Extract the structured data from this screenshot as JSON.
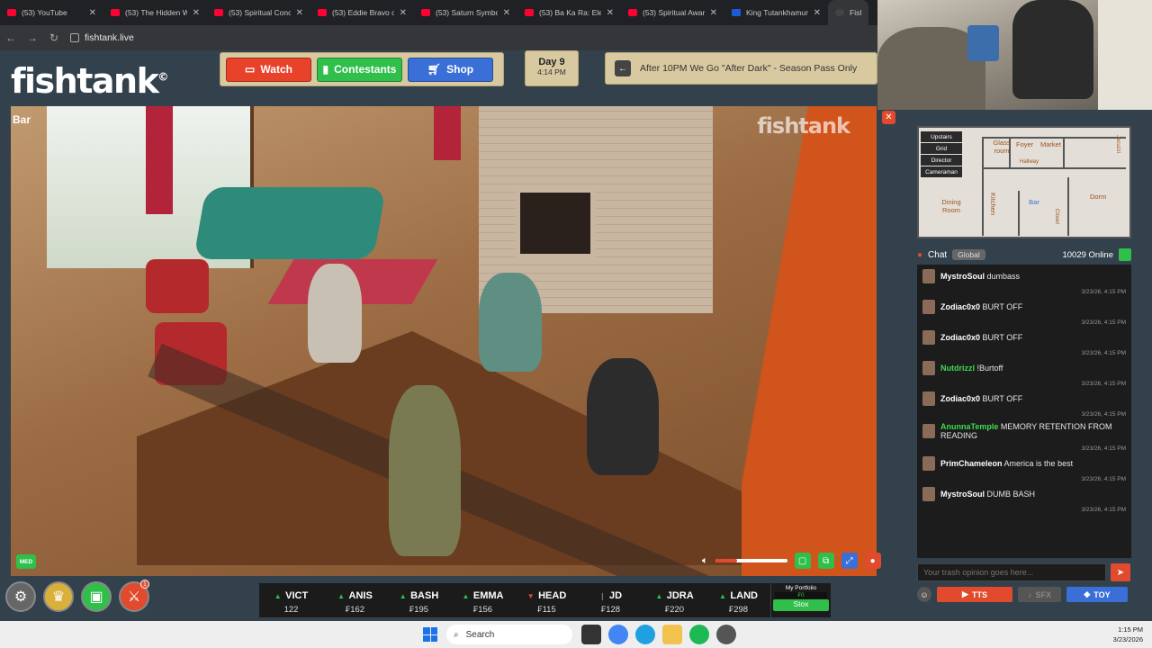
{
  "browser": {
    "tabs": [
      {
        "title": "(53) YouTube",
        "icon": "youtube-icon"
      },
      {
        "title": "(53) The Hidden W",
        "icon": "youtube-icon"
      },
      {
        "title": "(53) Spiritual Conc",
        "icon": "youtube-icon"
      },
      {
        "title": "(53) Eddie Bravo o",
        "icon": "youtube-icon"
      },
      {
        "title": "(53) Saturn Symbo",
        "icon": "youtube-icon"
      },
      {
        "title": "(53) Ba Ka Ra: Elec",
        "icon": "youtube-icon"
      },
      {
        "title": "(53) Spiritual Awar",
        "icon": "youtube-icon"
      },
      {
        "title": "King Tutankhamun",
        "icon": "m-icon"
      },
      {
        "title": "Fishta",
        "icon": "fishtank-icon"
      }
    ],
    "url": "fishtank.live"
  },
  "site": {
    "logo": "fishtank",
    "logo_mark": "©",
    "nav": {
      "watch": "Watch",
      "contestants": "Contestants",
      "shop": "Shop"
    },
    "day": "Day 9",
    "time": "4:14 PM",
    "announcement": "After 10PM We Go \"After Dark\" - Season Pass Only"
  },
  "video": {
    "camera_label": "Bar",
    "watermark": "fishtank",
    "quality_badge": "MED",
    "volume_level": 0.3
  },
  "dock": {
    "badge_count": "1"
  },
  "ticker": [
    {
      "name": "VICT",
      "dir": "up",
      "price": "122"
    },
    {
      "name": "ANIS",
      "dir": "up",
      "price": "₣162"
    },
    {
      "name": "BASH",
      "dir": "up",
      "price": "₣195"
    },
    {
      "name": "EMMA",
      "dir": "up",
      "price": "₣156"
    },
    {
      "name": "HEAD",
      "dir": "down",
      "price": "₣115"
    },
    {
      "name": "JD",
      "dir": "flat",
      "price": "₣128"
    },
    {
      "name": "JDRA",
      "dir": "up",
      "price": "₣220"
    },
    {
      "name": "LAND",
      "dir": "up",
      "price": "₣298"
    }
  ],
  "portfolio": {
    "label": "My Portfolio",
    "value": "₣0",
    "button": "Stox"
  },
  "map": {
    "buttons": [
      "Upstairs",
      "Grid",
      "Director",
      "Cameraman"
    ],
    "rooms": [
      "Glass room",
      "Foyer",
      "Market",
      "Jacuzzi",
      "Hallway",
      "Dining Room",
      "Kitchen",
      "Bar",
      "Closet",
      "Dorm"
    ]
  },
  "chat": {
    "title": "Chat",
    "tab": "Global",
    "online": "10029 Online",
    "messages": [
      {
        "user": "MystroSoul",
        "text": "dumbass",
        "time": "3/23/26, 4:15 PM",
        "color": "#ffffff"
      },
      {
        "user": "Zodiac0x0",
        "text": "BURT OFF",
        "time": "3/23/26, 4:15 PM",
        "color": "#ffffff"
      },
      {
        "user": "Zodiac0x0",
        "text": "BURT OFF",
        "time": "3/23/26, 4:15 PM",
        "color": "#ffffff"
      },
      {
        "user": "Nutdrizzl",
        "text": "!Burtoff",
        "time": "3/23/26, 4:15 PM",
        "color": "#3ddc4f"
      },
      {
        "user": "Zodiac0x0",
        "text": "BURT OFF",
        "time": "3/23/26, 4:15 PM",
        "color": "#ffffff"
      },
      {
        "user": "AnunnaTemple",
        "text": "MEMORY RETENTION FROM READING",
        "time": "3/23/26, 4:15 PM",
        "color": "#3ddc4f"
      },
      {
        "user": "PrimChameleon",
        "text": "America is the best",
        "time": "3/23/26, 4:15 PM",
        "color": "#ffffff"
      },
      {
        "user": "MystroSoul",
        "text": "DUMB BASH",
        "time": "3/23/26, 4:15 PM",
        "color": "#ffffff"
      }
    ],
    "input_placeholder": "Your trash opinion goes here...",
    "buttons": {
      "tts": "TTS",
      "sfx": "SFX",
      "toy": "TOY"
    }
  },
  "taskbar": {
    "search": "Search",
    "time": "1:15 PM",
    "date": "3/23/2026"
  },
  "colors": {
    "accent_red": "#e14a2c",
    "accent_green": "#2fbf4a",
    "accent_blue": "#3a6fd8",
    "panel_bg": "#33414d",
    "beige": "#d8c9a0"
  }
}
